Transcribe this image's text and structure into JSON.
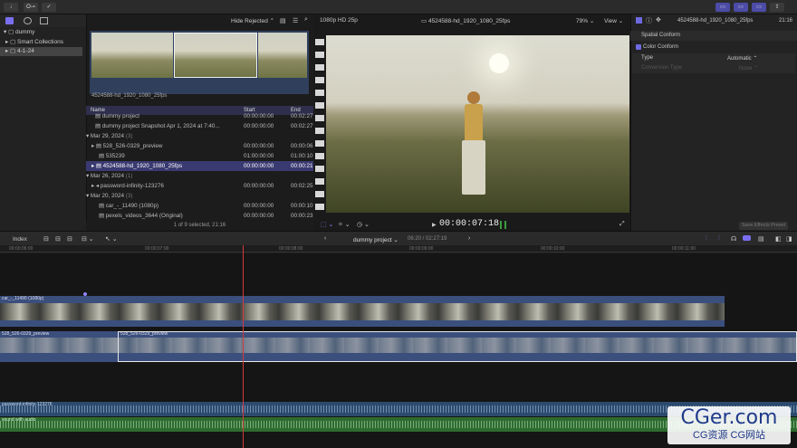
{
  "topbar": {
    "btn_key": "O⊸"
  },
  "library": {
    "items": [
      {
        "label": "dummy",
        "indent": 0
      },
      {
        "label": "Smart Collections",
        "indent": 1
      },
      {
        "label": "4-1-24",
        "indent": 1
      }
    ]
  },
  "browser": {
    "filter": "Hide Rejected",
    "clip_label": "4524588-hd_1920_1080_25fps",
    "headers": {
      "name": "Name",
      "start": "Start",
      "end": "End"
    },
    "rows": [
      {
        "name": "dummy project",
        "start": "00:00:00:00",
        "end": "00:02:27",
        "type": "item"
      },
      {
        "name": "dummy project Snapshot Apr 1, 2024 at 7:40...",
        "start": "00:00:00:00",
        "end": "00:02:27",
        "type": "item"
      },
      {
        "name": "Mar 29, 2024",
        "count": "(3)",
        "type": "group"
      },
      {
        "name": "528_526-0329_preview",
        "start": "00:00:00:00",
        "end": "00:00:06",
        "type": "item"
      },
      {
        "name": "535239",
        "start": "01:00:00:00",
        "end": "01:00:10",
        "type": "item"
      },
      {
        "name": "4524588-hd_1920_1080_25fps",
        "start": "00:00:00:00",
        "end": "00:00:21",
        "type": "item",
        "selected": true
      },
      {
        "name": "Mar 26, 2024",
        "count": "(1)",
        "type": "group"
      },
      {
        "name": "password-infinity-123276",
        "start": "00:00:00:00",
        "end": "00:02:25",
        "type": "item"
      },
      {
        "name": "Mar 20, 2024",
        "count": "(3)",
        "type": "group"
      },
      {
        "name": "car_-_11490 (1080p)",
        "start": "00:00:00:00",
        "end": "00:00:10",
        "type": "item"
      },
      {
        "name": "pexels_videos_3644 (Original)",
        "start": "00:00:00:00",
        "end": "00:00:23",
        "type": "item"
      }
    ],
    "status": "1 of 9 selected, 21:16"
  },
  "viewer": {
    "format": "1080p HD 25p",
    "clip_name": "4524588-hd_1920_1080_25fps",
    "zoom": "79%",
    "view": "View",
    "timecode": "00:00:07:18"
  },
  "inspector": {
    "duration": "21:16",
    "clip_name": "4524588-hd_1920_1080_25fps",
    "section": "Spatial Conform",
    "color_conform": "Color Conform",
    "type_label": "Type",
    "type_value": "Automatic",
    "conversion_label": "Conversion Type",
    "conversion_value": "None",
    "save_preset": "Save Effects Preset"
  },
  "timeline": {
    "index": "Index",
    "project": "dummy project",
    "position": "06:20 / 02:27:19",
    "ruler_ticks": [
      "00:00:06:00",
      "00:00:07:00",
      "00:00:08:00",
      "00:00:09:00",
      "00:00:10:00",
      "00:00:11:00"
    ],
    "clips": {
      "car": "car_-_11490 (1080p)",
      "preview_a": "528_526-0329_preview",
      "preview_b": "528_526-0329_preview",
      "audio_a": "password-infinity-123276",
      "audio_b": "sound with audio"
    }
  },
  "watermark": {
    "big": "CGer.com",
    "small": "CG资源 CG网站"
  }
}
